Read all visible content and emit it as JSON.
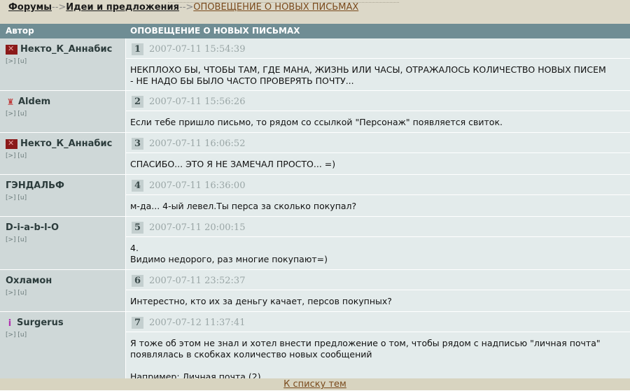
{
  "breadcrumb": {
    "forums": "Форумы",
    "sep": "-->",
    "ideas": "Идеи и предложения",
    "current": "ОПОВЕЩЕНИЕ О НОВЫХ ПИСЬМАХ"
  },
  "table_header": {
    "author": "Автор",
    "title": "ОПОВЕЩЕНИЕ О НОВЫХ ПИСЬМАХ"
  },
  "posts": [
    {
      "author": "Некто_К_Аннабис",
      "avatar": "red-x-icon",
      "links": "[>] [u]",
      "num": "1",
      "datetime": "2007-07-11 15:54:39",
      "text": "НЕКПЛОХО БЫ, ЧТОБЫ ТАМ, ГДЕ МАНА, ЖИЗНЬ ИЛИ ЧАСЫ, ОТРАЖАЛОСЬ КОЛИЧЕСТВО НОВЫХ ПИСЕМ\n- НЕ НАДО БЫ БЫЛО ЧАСТО ПРОВЕРЯТЬ ПОЧТУ..."
    },
    {
      "author": "Aldem",
      "avatar": "figure-icon",
      "links": "[>] [u]",
      "num": "2",
      "datetime": "2007-07-11 15:56:26",
      "text": "Если тебе пришло письмо, то рядом со ссылкой \"Персонаж\" появляется свиток."
    },
    {
      "author": "Некто_К_Аннабис",
      "avatar": "red-x-icon",
      "links": "[>] [u]",
      "num": "3",
      "datetime": "2007-07-11 16:06:52",
      "text": "СПАСИБО... ЭТО Я НЕ ЗАМЕЧАЛ ПРОСТО... =)"
    },
    {
      "author": "ГЭНДАЛЬФ",
      "avatar": "",
      "links": "[>] [u]",
      "num": "4",
      "datetime": "2007-07-11 16:36:00",
      "text": "м-да... 4-ый левел.Ты перса за сколько покупал?"
    },
    {
      "author": "D-i-a-b-l-O",
      "avatar": "",
      "links": "[>] [u]",
      "num": "5",
      "datetime": "2007-07-11 20:00:15",
      "text": "4.\nВидимо недорого, раз многие покупают=)"
    },
    {
      "author": "Охламон",
      "avatar": "",
      "links": "[>] [u]",
      "num": "6",
      "datetime": "2007-07-11 23:52:37",
      "text": "Интерестно, кто их за деньгу качает, персов покупных?"
    },
    {
      "author": "Surgerus",
      "avatar": "i-icon",
      "links": "[>] [u]",
      "num": "7",
      "datetime": "2007-07-12 11:37:41",
      "text": "Я тоже об этом не знал и хотел внести предложение о том, чтобы рядом с надписью \"личная почта\"\nпоявлялась в скобках количество новых сообщений\n\nНапример: Личная почта (2)"
    }
  ],
  "footer": {
    "back_link": "К списку тем"
  }
}
